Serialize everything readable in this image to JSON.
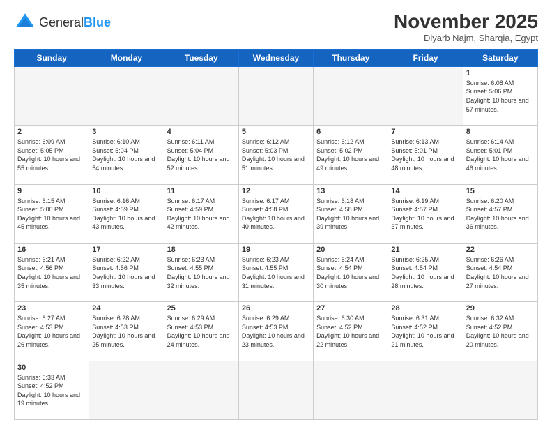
{
  "header": {
    "logo_general": "General",
    "logo_blue": "Blue",
    "month_title": "November 2025",
    "location": "Diyarb Najm, Sharqia, Egypt"
  },
  "weekdays": [
    "Sunday",
    "Monday",
    "Tuesday",
    "Wednesday",
    "Thursday",
    "Friday",
    "Saturday"
  ],
  "weeks": [
    [
      {
        "day": "",
        "info": ""
      },
      {
        "day": "",
        "info": ""
      },
      {
        "day": "",
        "info": ""
      },
      {
        "day": "",
        "info": ""
      },
      {
        "day": "",
        "info": ""
      },
      {
        "day": "",
        "info": ""
      },
      {
        "day": "1",
        "info": "Sunrise: 6:08 AM\nSunset: 5:06 PM\nDaylight: 10 hours\nand 57 minutes."
      }
    ],
    [
      {
        "day": "2",
        "info": "Sunrise: 6:09 AM\nSunset: 5:05 PM\nDaylight: 10 hours\nand 55 minutes."
      },
      {
        "day": "3",
        "info": "Sunrise: 6:10 AM\nSunset: 5:04 PM\nDaylight: 10 hours\nand 54 minutes."
      },
      {
        "day": "4",
        "info": "Sunrise: 6:11 AM\nSunset: 5:04 PM\nDaylight: 10 hours\nand 52 minutes."
      },
      {
        "day": "5",
        "info": "Sunrise: 6:12 AM\nSunset: 5:03 PM\nDaylight: 10 hours\nand 51 minutes."
      },
      {
        "day": "6",
        "info": "Sunrise: 6:12 AM\nSunset: 5:02 PM\nDaylight: 10 hours\nand 49 minutes."
      },
      {
        "day": "7",
        "info": "Sunrise: 6:13 AM\nSunset: 5:01 PM\nDaylight: 10 hours\nand 48 minutes."
      },
      {
        "day": "8",
        "info": "Sunrise: 6:14 AM\nSunset: 5:01 PM\nDaylight: 10 hours\nand 46 minutes."
      }
    ],
    [
      {
        "day": "9",
        "info": "Sunrise: 6:15 AM\nSunset: 5:00 PM\nDaylight: 10 hours\nand 45 minutes."
      },
      {
        "day": "10",
        "info": "Sunrise: 6:16 AM\nSunset: 4:59 PM\nDaylight: 10 hours\nand 43 minutes."
      },
      {
        "day": "11",
        "info": "Sunrise: 6:17 AM\nSunset: 4:59 PM\nDaylight: 10 hours\nand 42 minutes."
      },
      {
        "day": "12",
        "info": "Sunrise: 6:17 AM\nSunset: 4:58 PM\nDaylight: 10 hours\nand 40 minutes."
      },
      {
        "day": "13",
        "info": "Sunrise: 6:18 AM\nSunset: 4:58 PM\nDaylight: 10 hours\nand 39 minutes."
      },
      {
        "day": "14",
        "info": "Sunrise: 6:19 AM\nSunset: 4:57 PM\nDaylight: 10 hours\nand 37 minutes."
      },
      {
        "day": "15",
        "info": "Sunrise: 6:20 AM\nSunset: 4:57 PM\nDaylight: 10 hours\nand 36 minutes."
      }
    ],
    [
      {
        "day": "16",
        "info": "Sunrise: 6:21 AM\nSunset: 4:56 PM\nDaylight: 10 hours\nand 35 minutes."
      },
      {
        "day": "17",
        "info": "Sunrise: 6:22 AM\nSunset: 4:56 PM\nDaylight: 10 hours\nand 33 minutes."
      },
      {
        "day": "18",
        "info": "Sunrise: 6:23 AM\nSunset: 4:55 PM\nDaylight: 10 hours\nand 32 minutes."
      },
      {
        "day": "19",
        "info": "Sunrise: 6:23 AM\nSunset: 4:55 PM\nDaylight: 10 hours\nand 31 minutes."
      },
      {
        "day": "20",
        "info": "Sunrise: 6:24 AM\nSunset: 4:54 PM\nDaylight: 10 hours\nand 30 minutes."
      },
      {
        "day": "21",
        "info": "Sunrise: 6:25 AM\nSunset: 4:54 PM\nDaylight: 10 hours\nand 28 minutes."
      },
      {
        "day": "22",
        "info": "Sunrise: 6:26 AM\nSunset: 4:54 PM\nDaylight: 10 hours\nand 27 minutes."
      }
    ],
    [
      {
        "day": "23",
        "info": "Sunrise: 6:27 AM\nSunset: 4:53 PM\nDaylight: 10 hours\nand 26 minutes."
      },
      {
        "day": "24",
        "info": "Sunrise: 6:28 AM\nSunset: 4:53 PM\nDaylight: 10 hours\nand 25 minutes."
      },
      {
        "day": "25",
        "info": "Sunrise: 6:29 AM\nSunset: 4:53 PM\nDaylight: 10 hours\nand 24 minutes."
      },
      {
        "day": "26",
        "info": "Sunrise: 6:29 AM\nSunset: 4:53 PM\nDaylight: 10 hours\nand 23 minutes."
      },
      {
        "day": "27",
        "info": "Sunrise: 6:30 AM\nSunset: 4:52 PM\nDaylight: 10 hours\nand 22 minutes."
      },
      {
        "day": "28",
        "info": "Sunrise: 6:31 AM\nSunset: 4:52 PM\nDaylight: 10 hours\nand 21 minutes."
      },
      {
        "day": "29",
        "info": "Sunrise: 6:32 AM\nSunset: 4:52 PM\nDaylight: 10 hours\nand 20 minutes."
      }
    ],
    [
      {
        "day": "30",
        "info": "Sunrise: 6:33 AM\nSunset: 4:52 PM\nDaylight: 10 hours\nand 19 minutes."
      },
      {
        "day": "",
        "info": ""
      },
      {
        "day": "",
        "info": ""
      },
      {
        "day": "",
        "info": ""
      },
      {
        "day": "",
        "info": ""
      },
      {
        "day": "",
        "info": ""
      },
      {
        "day": "",
        "info": ""
      }
    ]
  ]
}
